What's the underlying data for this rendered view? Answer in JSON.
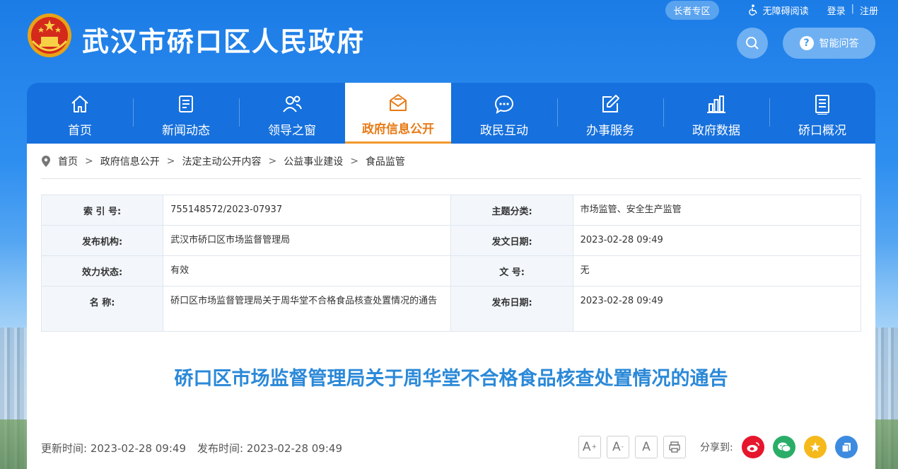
{
  "header": {
    "site_title": "武汉市硚口区人民政府",
    "elder_zone": "长者专区",
    "accessibility": "无障碍阅读",
    "login": "登录",
    "separator": "|",
    "register": "注册",
    "ai_qa": "智能问答",
    "ai_qa_icon_text": "?"
  },
  "nav": {
    "items": [
      {
        "label": "首页",
        "icon": "home-icon"
      },
      {
        "label": "新闻动态",
        "icon": "news-icon"
      },
      {
        "label": "领导之窗",
        "icon": "leaders-icon"
      },
      {
        "label": "政府信息公开",
        "icon": "envelope-icon",
        "active": true
      },
      {
        "label": "政民互动",
        "icon": "chat-icon"
      },
      {
        "label": "办事服务",
        "icon": "edit-icon"
      },
      {
        "label": "政府数据",
        "icon": "bar-chart-icon"
      },
      {
        "label": "硚口概况",
        "icon": "document-icon"
      }
    ]
  },
  "breadcrumb": {
    "items": [
      "首页",
      "政府信息公开",
      "法定主动公开内容",
      "公益事业建设",
      "食品监管"
    ],
    "arrow": ">"
  },
  "meta": {
    "index_label": "索 引 号:",
    "index_value": "755148572/2023-07937",
    "topic_label": "主题分类:",
    "topic_value": "市场监管、安全生产监管",
    "publisher_label": "发布机构:",
    "publisher_value": "武汉市硚口区市场监督管理局",
    "issue_date_label": "发文日期:",
    "issue_date_value": "2023-02-28 09:49",
    "status_label": "效力状态:",
    "status_value": "有效",
    "doc_no_label": "文 号:",
    "doc_no_value": "无",
    "name_label": "名 称:",
    "name_value": "硚口区市场监督管理局关于周华堂不合格食品核查处置情况的通告",
    "publish_date_label": "发布日期:",
    "publish_date_value": "2023-02-28 09:49"
  },
  "document": {
    "title": "硚口区市场监督管理局关于周华堂不合格食品核查处置情况的通告"
  },
  "footer": {
    "updated": "更新时间:  2023-02-28 09:49",
    "published": "发布时间:  2023-02-28 09:49",
    "font_large": "A",
    "font_large_sup": "+",
    "font_small": "A",
    "font_small_sup": "-",
    "font_default": "A",
    "share_label": "分享到:"
  },
  "colors": {
    "nav_bg": "#1670dd",
    "accent_orange": "#e87a15",
    "title_blue": "#2b89d8",
    "weibo": "#e6162d",
    "wechat": "#2aae67",
    "qzone": "#f5b91c",
    "copy": "#3d8be0"
  }
}
